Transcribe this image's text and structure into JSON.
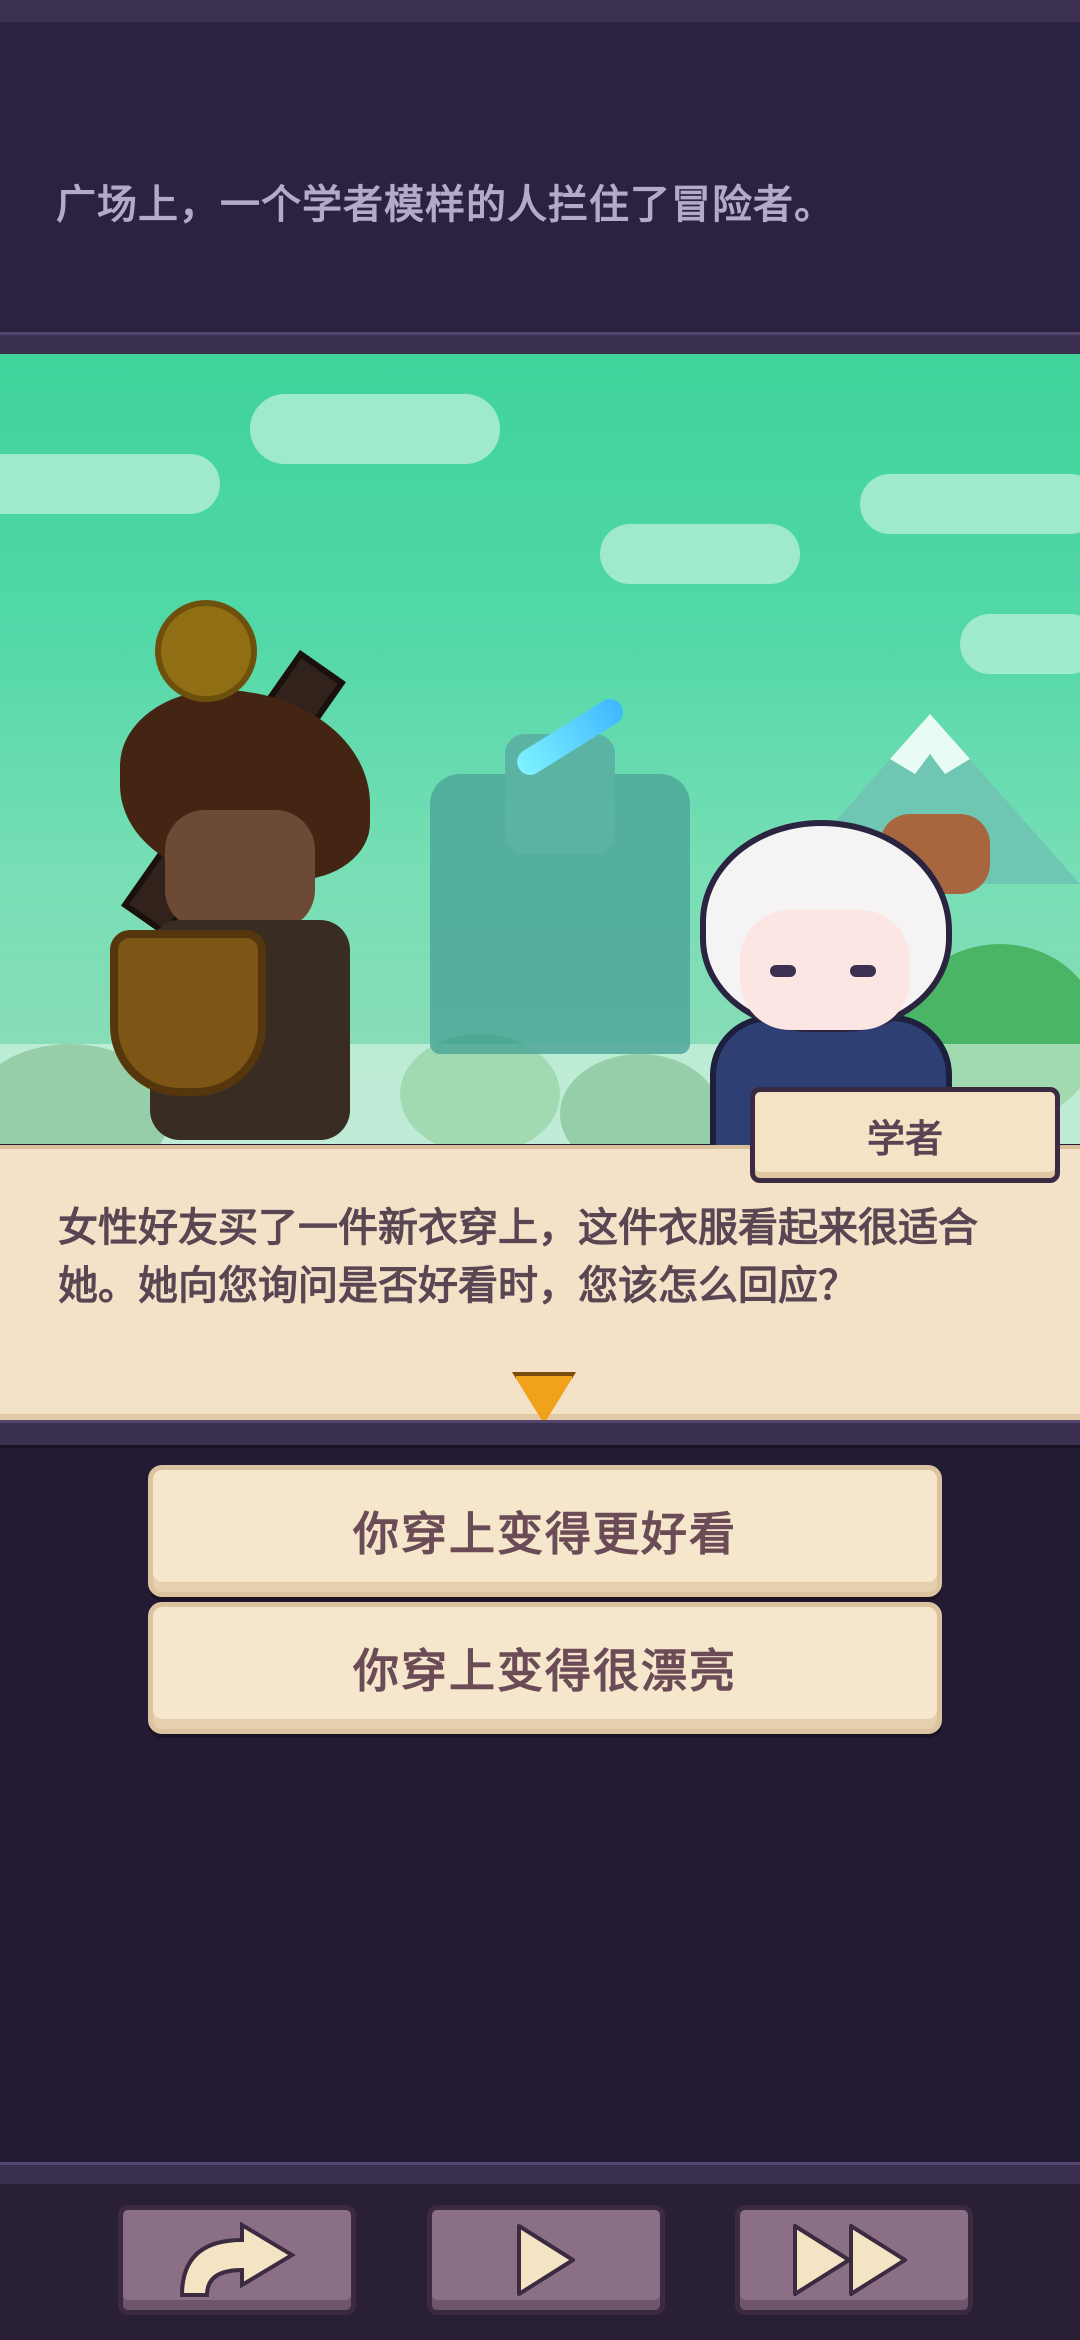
{
  "narration": {
    "text": "广场上，一个学者模样的人拦住了冒险者。"
  },
  "speaker": {
    "name": "学者"
  },
  "dialogue": {
    "text": "女性好友买了一件新衣穿上，这件衣服看起来很适合她。她向您询问是否好看时，您该怎么回应？"
  },
  "choices": [
    {
      "label": "你穿上变得更好看"
    },
    {
      "label": "你穿上变得很漂亮"
    }
  ],
  "controls": [
    {
      "icon": "back-arrow-icon"
    },
    {
      "icon": "play-icon"
    },
    {
      "icon": "fast-forward-icon"
    }
  ],
  "colors": {
    "background": "#231a33",
    "dialogue_bg": "#f3e1c8",
    "accent": "#f0a21b"
  }
}
